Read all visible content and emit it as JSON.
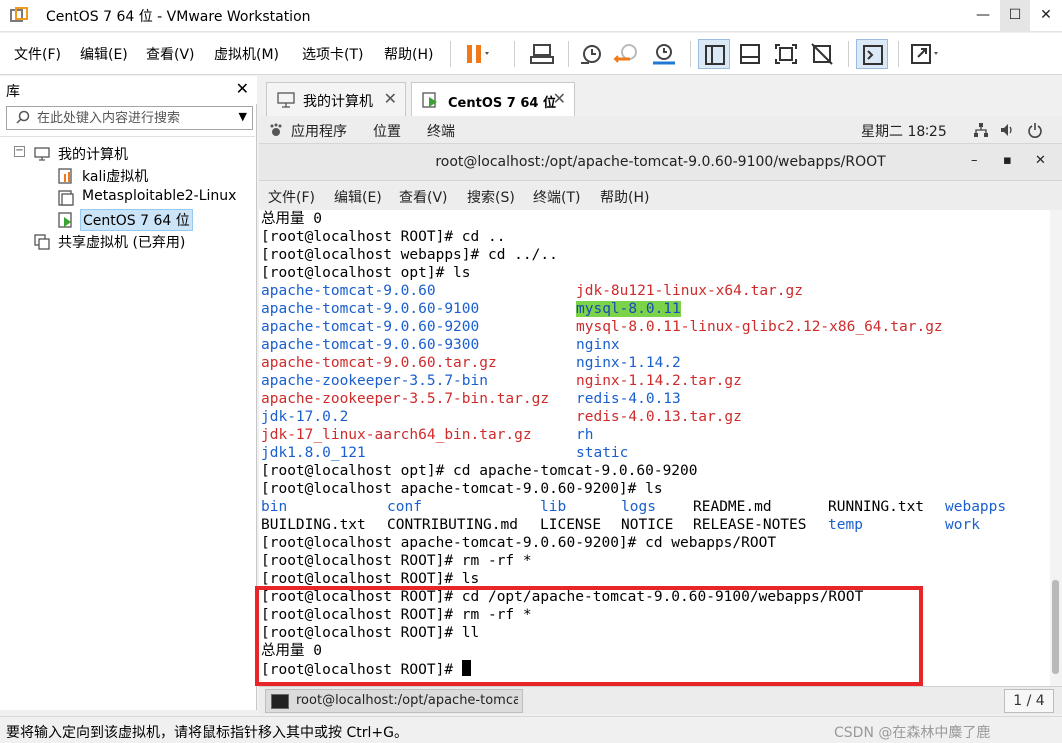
{
  "window": {
    "title": "CentOS 7 64 位 - VMware Workstation",
    "minimize": "—",
    "maximize": "☐",
    "close": "✕"
  },
  "menubar": {
    "file": "文件(F)",
    "edit": "编辑(E)",
    "view": "查看(V)",
    "vm": "虚拟机(M)",
    "tabs": "选项卡(T)",
    "help": "帮助(H)"
  },
  "library": {
    "title": "库",
    "close": "✕",
    "search_placeholder": "在此处键入内容进行搜索",
    "tree": {
      "root": "我的计算机",
      "items": [
        "kali虚拟机",
        "Metasploitable2-Linux",
        "CentOS 7 64 位"
      ],
      "shared": "共享虚拟机 (已弃用)"
    }
  },
  "tabs": [
    {
      "label": "我的计算机",
      "close": "✕"
    },
    {
      "label": "CentOS 7 64 位",
      "close": "✕"
    }
  ],
  "gnome": {
    "apps": "应用程序",
    "places": "位置",
    "terminal": "终端",
    "datetime": "星期二 18∶25"
  },
  "terminal_window": {
    "title": "root@localhost:/opt/apache-tomcat-9.0.60-9100/webapps/ROOT",
    "btn_min": "–",
    "btn_max": "▪",
    "btn_close": "✕",
    "menu": {
      "file": "文件(F)",
      "edit": "编辑(E)",
      "view": "查看(V)",
      "search": "搜索(S)",
      "terminal": "终端(T)",
      "help": "帮助(H)"
    }
  },
  "terminal": {
    "line01": "总用量 0",
    "line02": "[root@localhost ROOT]# cd ..",
    "line03": "[root@localhost webapps]# cd ../..",
    "line04": "[root@localhost opt]# ls",
    "ls1": {
      "left": [
        "apache-tomcat-9.0.60",
        "apache-tomcat-9.0.60-9100",
        "apache-tomcat-9.0.60-9200",
        "apache-tomcat-9.0.60-9300",
        "apache-tomcat-9.0.60.tar.gz",
        "apache-zookeeper-3.5.7-bin",
        "apache-zookeeper-3.5.7-bin.tar.gz",
        "jdk-17.0.2",
        "jdk-17_linux-aarch64_bin.tar.gz",
        "jdk1.8.0_121"
      ],
      "right": [
        "jdk-8u121-linux-x64.tar.gz",
        "mysql-8.0.11",
        "mysql-8.0.11-linux-glibc2.12-x86_64.tar.gz",
        "nginx",
        "nginx-1.14.2",
        "nginx-1.14.2.tar.gz",
        "redis-4.0.13",
        "redis-4.0.13.tar.gz",
        "rh",
        "static"
      ]
    },
    "line15": "[root@localhost opt]# cd apache-tomcat-9.0.60-9200",
    "line16": "[root@localhost apache-tomcat-9.0.60-9200]# ls",
    "ls2": {
      "row1": [
        "bin",
        "conf",
        "lib",
        "logs",
        "README.md",
        "RUNNING.txt",
        "webapps"
      ],
      "row2": [
        "BUILDING.txt",
        "CONTRIBUTING.md",
        "LICENSE",
        "NOTICE",
        "RELEASE-NOTES",
        "temp",
        "work"
      ]
    },
    "line19": "[root@localhost apache-tomcat-9.0.60-9200]# cd webapps/ROOT",
    "line20": "[root@localhost ROOT]# rm -rf *",
    "line21": "[root@localhost ROOT]# ls",
    "line22": "[root@localhost ROOT]# cd /opt/apache-tomcat-9.0.60-9100/webapps/ROOT",
    "line23": "[root@localhost ROOT]# rm -rf *",
    "line24": "[root@localhost ROOT]# ll",
    "line25": "总用量 0",
    "line26": "[root@localhost ROOT]# "
  },
  "bottom": {
    "task": "root@localhost:/opt/apache-tomcat…",
    "pager": "1 / 4"
  },
  "statusbar": {
    "text": "要将输入定向到该虚拟机，请将鼠标指针移入其中或按 Ctrl+G。",
    "watermark": "CSDN @在森林中麋了鹿"
  },
  "colors": {
    "dir_blue": "#1a5fcf",
    "archive_red": "#cf2b2b",
    "highlight_green": "#7bd34a",
    "annotation_red": "#e8262a"
  }
}
